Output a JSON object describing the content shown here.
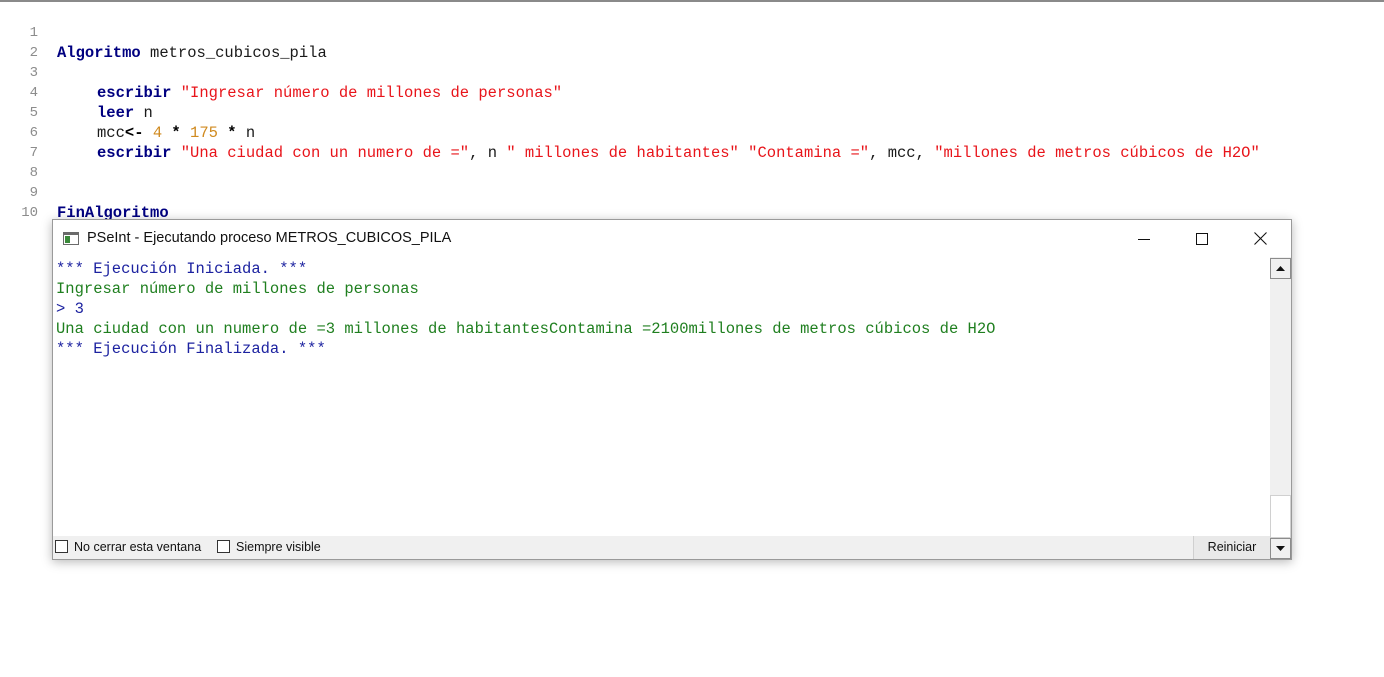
{
  "editor": {
    "lines": [
      {
        "n": "1"
      },
      {
        "n": "2"
      },
      {
        "n": "3"
      },
      {
        "n": "4"
      },
      {
        "n": "5"
      },
      {
        "n": "6"
      },
      {
        "n": "7"
      },
      {
        "n": "8"
      },
      {
        "n": "9"
      },
      {
        "n": "10"
      }
    ],
    "tokens": {
      "algoritmo_kw": "Algoritmo",
      "algoritmo_name": " metros_cubicos_pila",
      "escribir_kw": "escribir",
      "l3_str": "\"Ingresar número de millones de personas\"",
      "leer_kw": "leer",
      "l4_var": " n",
      "l5_var": "mcc",
      "l5_assign": "<-",
      "l5_num1": " 4",
      "l5_mul1": " *",
      "l5_num2": " 175",
      "l5_mul2": " *",
      "l5_n": " n",
      "l6_str1": "\"Una ciudad con un numero de =\"",
      "l6_sep1": ", n ",
      "l6_str2": "\" millones de habitantes\"",
      "l6_sp": " ",
      "l6_str3": "\"Contamina =\"",
      "l6_sep2": ", mcc, ",
      "l6_str4": "\"millones de metros cúbicos de H2O\"",
      "finalgoritmo_kw": "FinAlgoritmo"
    }
  },
  "window": {
    "title": "PSeInt - Ejecutando proceso METROS_CUBICOS_PILA",
    "console": [
      "*** Ejecución Iniciada. ***",
      "Ingresar número de millones de personas",
      "> 3",
      "Una ciudad con un numero de =3 millones de habitantesContamina =2100millones de metros cúbicos de H2O",
      "*** Ejecución Finalizada. ***"
    ],
    "status": {
      "no_cerrar": "No cerrar esta ventana",
      "siempre_visible": "Siempre visible",
      "reiniciar": "Reiniciar"
    }
  },
  "colors": {
    "keyword": "#000080",
    "string": "#e8141a",
    "number": "#d08a1f",
    "console_info": "#1c22a0",
    "console_output": "#1f7f1f"
  }
}
